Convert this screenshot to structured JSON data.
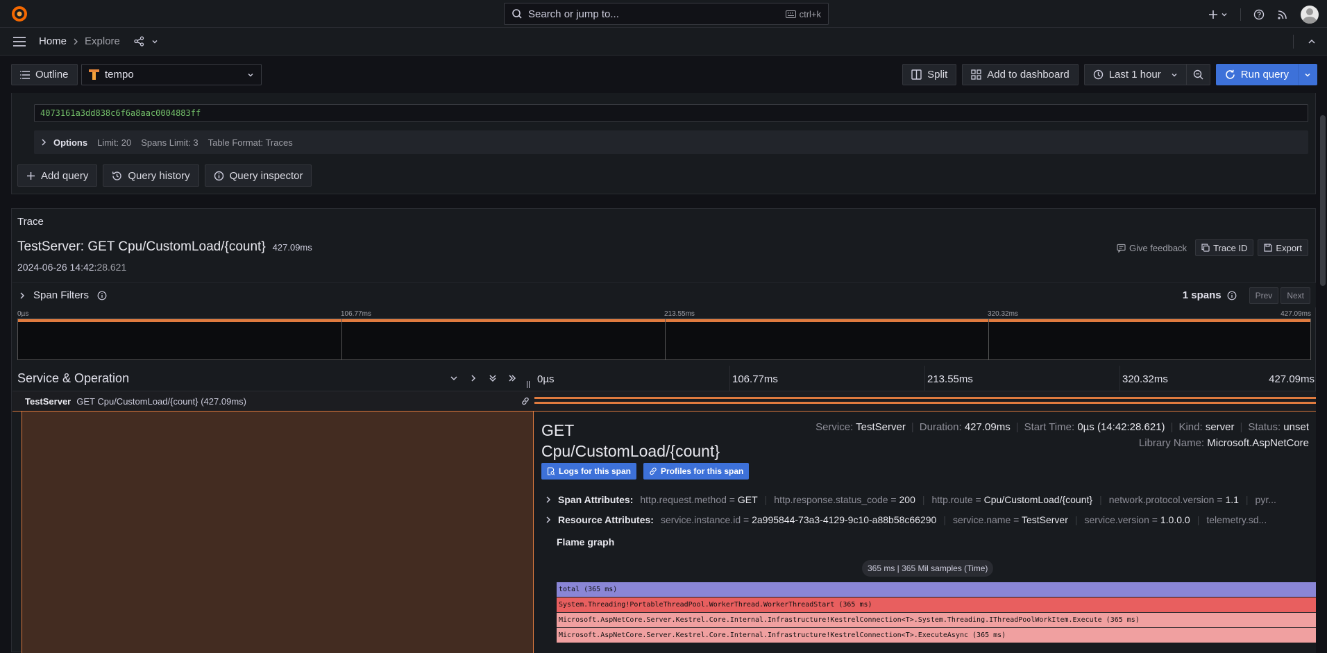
{
  "topbar": {
    "search_placeholder": "Search or jump to...",
    "search_shortcut": "ctrl+k"
  },
  "breadcrumb": {
    "home": "Home",
    "current": "Explore"
  },
  "toolbar": {
    "outline": "Outline",
    "datasource": "tempo",
    "split": "Split",
    "add_to_dashboard": "Add to dashboard",
    "time_range": "Last 1 hour",
    "run_query": "Run query"
  },
  "query": {
    "trace_id_value": "4073161a3dd838c6f6a8aac0004883ff",
    "options_label": "Options",
    "limit": "Limit: 20",
    "spans_limit": "Spans Limit: 3",
    "table_format": "Table Format: Traces",
    "add_query": "Add query",
    "query_history": "Query history",
    "query_inspector": "Query inspector"
  },
  "trace": {
    "panel_title": "Trace",
    "title": "TestServer: GET Cpu/CustomLoad/{count}",
    "duration": "427.09ms",
    "start_time_date": "2024-06-26 14:42:",
    "start_time_seconds": "28.621",
    "give_feedback": "Give feedback",
    "trace_id_button": "Trace ID",
    "export_button": "Export",
    "span_filters": "Span Filters",
    "spans_count": "1 spans",
    "prev": "Prev",
    "next": "Next",
    "minimap_ticks": [
      "0µs",
      "106.77ms",
      "213.55ms",
      "320.32ms",
      "427.09ms"
    ],
    "service_operation": "Service & Operation",
    "timeline_ticks": [
      "0µs",
      "106.77ms",
      "213.55ms",
      "320.32ms",
      "427.09ms"
    ]
  },
  "span": {
    "service": "TestServer",
    "operation": "GET Cpu/CustomLoad/{count} (427.09ms)",
    "detail_title_line1": "GET",
    "detail_title_line2": "Cpu/CustomLoad/{count}",
    "service_label": "Service:",
    "service_value": "TestServer",
    "duration_label": "Duration:",
    "duration_value": "427.09ms",
    "start_label": "Start Time:",
    "start_value": "0µs (14:42:28.621)",
    "kind_label": "Kind:",
    "kind_value": "server",
    "status_label": "Status:",
    "status_value": "unset",
    "library_label": "Library Name:",
    "library_value": "Microsoft.AspNetCore",
    "logs_button": "Logs for this span",
    "profiles_button": "Profiles for this span",
    "span_attributes_label": "Span Attributes:",
    "span_attributes": [
      {
        "key": "http.request.method",
        "value": "GET"
      },
      {
        "key": "http.response.status_code",
        "value": "200"
      },
      {
        "key": "http.route",
        "value": "Cpu/CustomLoad/{count}"
      },
      {
        "key": "network.protocol.version",
        "value": "1.1"
      },
      {
        "key": "pyr...",
        "value": ""
      }
    ],
    "resource_attributes_label": "Resource Attributes:",
    "resource_attributes": [
      {
        "key": "service.instance.id",
        "value": "2a995844-73a3-4129-9c10-a88b58c66290"
      },
      {
        "key": "service.name",
        "value": "TestServer"
      },
      {
        "key": "service.version",
        "value": "1.0.0.0"
      },
      {
        "key": "telemetry.sd...",
        "value": ""
      }
    ],
    "flame_graph_title": "Flame graph",
    "flame_summary": "365 ms | 365 Mil samples (Time)",
    "flame_rows": [
      "total (365 ms)",
      "System.Threading!PortableThreadPool.WorkerThread.WorkerThreadStart (365 ms)",
      "Microsoft.AspNetCore.Server.Kestrel.Core.Internal.Infrastructure!KestrelConnection<T>.System.Threading.IThreadPoolWorkItem.Execute (365 ms)",
      "Microsoft.AspNetCore.Server.Kestrel.Core.Internal.Infrastructure!KestrelConnection<T>.ExecuteAsync (365 ms)"
    ]
  },
  "colors": {
    "accent": "#3d71d9",
    "span_bar": "#e07b3f",
    "flame_total": "#8a86d6",
    "flame_red": "#e85f5f",
    "flame_pink": "#f0a0a0"
  }
}
